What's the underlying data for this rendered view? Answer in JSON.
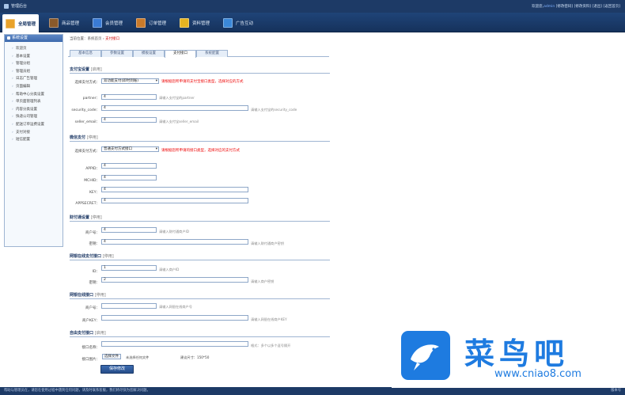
{
  "app": {
    "title": "管理后台",
    "user_prefix": "欢迎您,",
    "user_name": "admin",
    "user_links": "[修改密码] [修改资料] [退出] [返回首页]"
  },
  "nav": [
    {
      "label": "全局管理",
      "color": "#e9a22a"
    },
    {
      "label": "商品管理",
      "color": "#8a5a2b"
    },
    {
      "label": "会员管理",
      "color": "#3a7bd5"
    },
    {
      "label": "订单管理",
      "color": "#c97a2a"
    },
    {
      "label": "资料管理",
      "color": "#e6b422"
    },
    {
      "label": "广告互动",
      "color": "#3b88d8"
    }
  ],
  "sidebar": {
    "header": "系统设置",
    "items": [
      "欢迎页",
      "基本设置",
      "管理分组",
      "管理员组",
      "日志广告管理",
      "页面编辑",
      "帮助中心分类设置",
      "单页面管理列表",
      "内容分类设置",
      "快递公司管理",
      "配送订单运费设置",
      "支付对接",
      "短信配置"
    ]
  },
  "breadcrumb": {
    "prefix": "当前位置：系统首页 › ",
    "current": "支付接口"
  },
  "tabs": [
    "基本信息",
    "参数设置",
    "模板设置",
    "支付接口",
    "系统配置"
  ],
  "sections": {
    "alipay": {
      "title": "支付宝设置",
      "tag": "[启用]",
      "type_label": "选择支付方式：",
      "type_value": "双功能支付(即时到账)",
      "type_warn": "请根据您所申请的支付宝接口类型，选择对应的方式",
      "partner_label": "partner：",
      "partner_value": "4",
      "partner_hint": "请输入支付宝的partner",
      "code_label": "security_code：",
      "code_value": "4",
      "code_hint": "请输入支付宝的security_code",
      "email_label": "seller_email：",
      "email_value": "4",
      "email_hint": "请输入支付宝seller_email"
    },
    "wechat": {
      "title": "微信支付",
      "tag": "[停用]",
      "type_label": "选择支付方式：",
      "type_value": "普通支付方式接口",
      "type_warn": "请根据您所申请的接口类型，选择对应的支付方式",
      "appid_label": "APPID：",
      "appid_value": "4",
      "mchid_label": "MCHID：",
      "mchid_value": "4",
      "key_label": "KEY：",
      "key_value": "4",
      "secret_label": "APPSECRET：",
      "secret_value": "4"
    },
    "tenpay": {
      "title": "财付通设置",
      "tag": "[停用]",
      "acct_label": "商户号：",
      "acct_value": "4",
      "acct_hint": "请输入财付通商户ID",
      "key_label": "密钥：",
      "key_value": "4",
      "key_hint": "请输入财付通商户密钥"
    },
    "wallet": {
      "title": "网银在线支付接口",
      "tag": "[停用]",
      "id_label": "ID：",
      "id_value": "1",
      "id_hint": "请输入商户ID",
      "key_label": "密钥：",
      "key_value": "2",
      "key_hint": "请输入商户密钥"
    },
    "chinabank": {
      "title": "网银在线接口",
      "tag": "[停用]",
      "acct_label": "商户号：",
      "acct_value": "",
      "acct_hint": "请输入网银在线商户号",
      "key_label": "商户KEY：",
      "key_value": "",
      "key_hint": "请输入网银在线商户KEY"
    },
    "offline": {
      "title": "自由支付接口",
      "tag": "[启用]",
      "name_label": "接口名称：",
      "name_value": "",
      "name_hint": "格式：多个以多个逗号隔开",
      "file_label": "接口图片：",
      "file_button": "选择文件",
      "file_text": "未选择任何文件",
      "size_hint": "建议尺寸：150*50"
    }
  },
  "save_button": "保存修改",
  "footer": {
    "left": "帮助与管理员在，请您在使用过程中遇到任何问题，请及时联系客服，我们将尽快为您解决问题。",
    "right": "版本号"
  },
  "watermark": {
    "cn": "菜鸟吧",
    "url": "www.cniao8.com"
  }
}
